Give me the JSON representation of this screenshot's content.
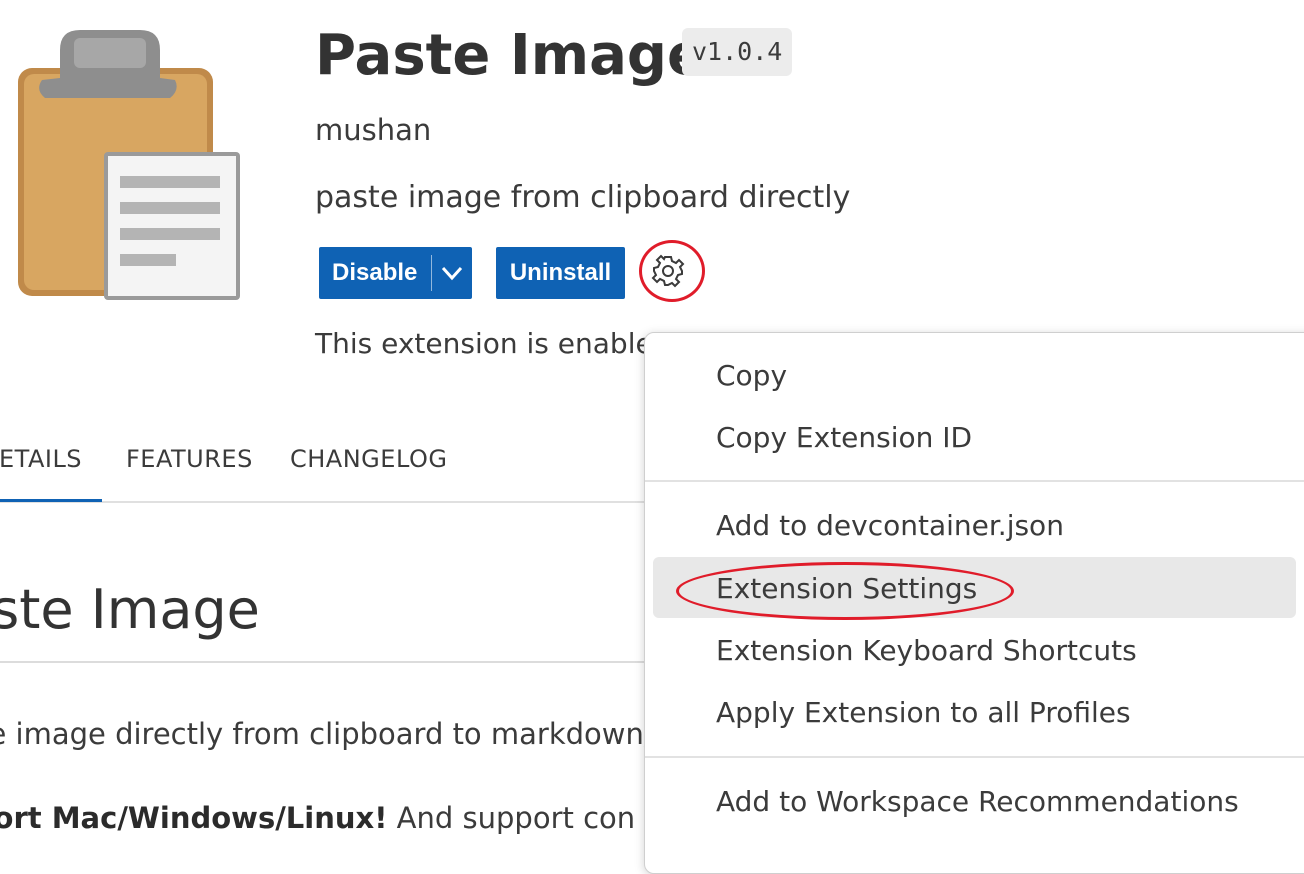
{
  "extension": {
    "name": "Paste Image",
    "version": "v1.0.4",
    "publisher": "mushan",
    "description": "paste image from clipboard directly",
    "status": "This extension is enabled"
  },
  "actions": {
    "disable_label": "Disable",
    "uninstall_label": "Uninstall"
  },
  "tabs": [
    {
      "label": "DETAILS"
    },
    {
      "label": "FEATURES"
    },
    {
      "label": "CHANGELOG"
    }
  ],
  "readme": {
    "heading": "aste Image",
    "paragraph1": "ste image directly from clipboard to markdown/",
    "paragraph2_bold": "pport Mac/Windows/Linux!",
    "paragraph2_rest": " And support con"
  },
  "context_menu": {
    "items": [
      {
        "label": "Copy"
      },
      {
        "label": "Copy Extension ID"
      },
      {
        "label": "Add to devcontainer.json"
      },
      {
        "label": "Extension Settings"
      },
      {
        "label": "Extension Keyboard Shortcuts"
      },
      {
        "label": "Apply Extension to all Profiles"
      },
      {
        "label": "Add to Workspace Recommendations"
      }
    ],
    "highlighted": "Extension Settings"
  },
  "colors": {
    "primary_button": "#0f62b4",
    "annotation": "#e01c2a",
    "menu_highlight": "#e8e8e8"
  },
  "icons": {
    "extension_icon": "clipboard-icon",
    "manage": "gear-icon",
    "dropdown": "chevron-down-icon"
  }
}
